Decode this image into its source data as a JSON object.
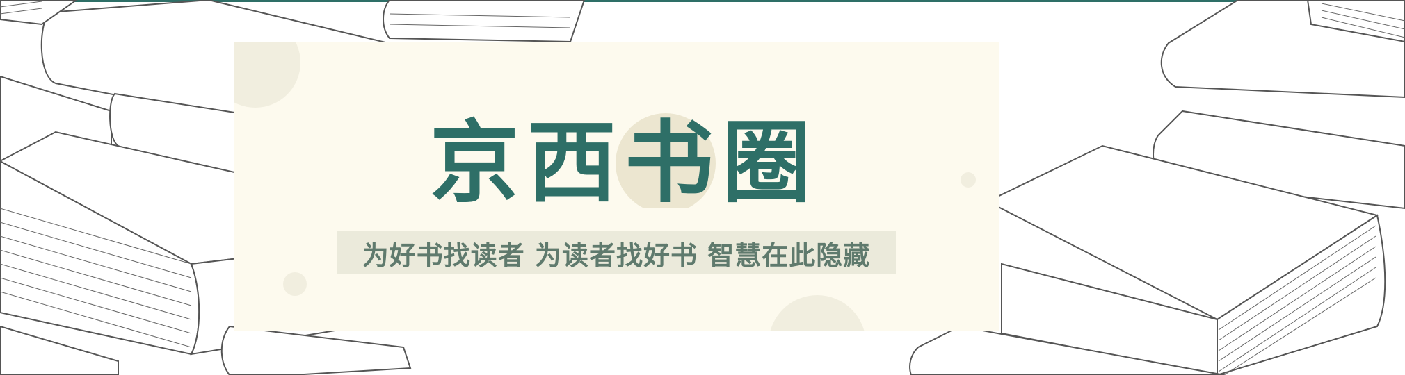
{
  "banner": {
    "title_chars": [
      "京",
      "西",
      "书",
      "圈"
    ],
    "tagline": "为好书找读者 为读者找好书 智慧在此隐藏"
  },
  "colors": {
    "brand_green": "#2e6f67",
    "card_background": "#fdfaee",
    "tagline_background": "#ebeadb",
    "tagline_text": "#5f7a6d",
    "accent_circle": "#ece6d0",
    "deco_circle": "#f1eedf",
    "line_art": "#555555"
  },
  "icons": [
    "stacked-books-illustration"
  ]
}
